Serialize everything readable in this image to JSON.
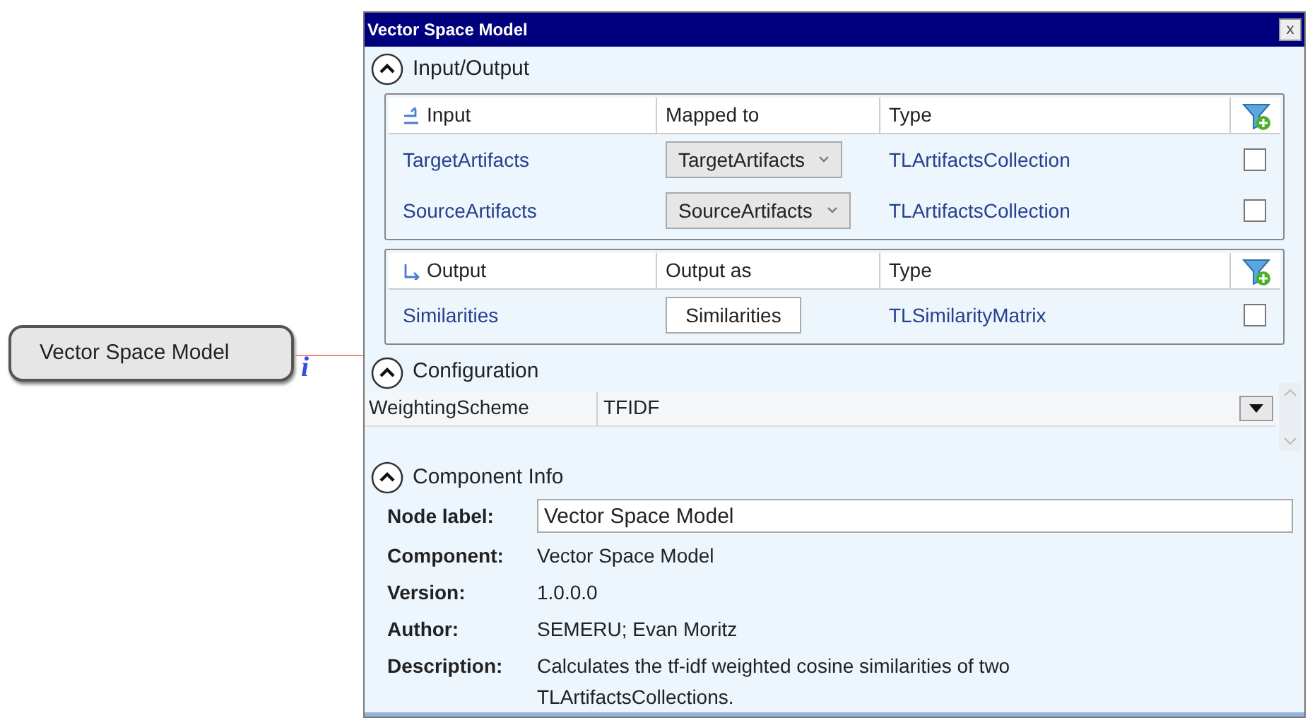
{
  "canvas_node": {
    "label": "Vector Space Model",
    "info": "i"
  },
  "window": {
    "title": "Vector Space Model",
    "close": "x"
  },
  "input_output": {
    "header": "Input/Output",
    "expanded": true,
    "tables": [
      {
        "kind": "input",
        "columns": [
          "Input",
          "Mapped to",
          "Type"
        ],
        "rows": [
          {
            "name": "TargetArtifacts",
            "mapped": "TargetArtifacts",
            "type": "TLArtifactsCollection",
            "checked": false
          },
          {
            "name": "SourceArtifacts",
            "mapped": "SourceArtifacts",
            "type": "TLArtifactsCollection",
            "checked": false
          }
        ]
      },
      {
        "kind": "output",
        "columns": [
          "Output",
          "Output as",
          "Type"
        ],
        "rows": [
          {
            "name": "Similarities",
            "mapped": "Similarities",
            "type": "TLSimilarityMatrix",
            "checked": false
          }
        ]
      }
    ]
  },
  "configuration": {
    "header": "Configuration",
    "expanded": true,
    "rows": [
      {
        "name": "WeightingScheme",
        "value": "TFIDF"
      }
    ]
  },
  "component_info": {
    "header": "Component Info",
    "expanded": true,
    "node_label": {
      "label": "Node label:",
      "value": "Vector Space Model"
    },
    "fields": [
      {
        "label": "Component:",
        "value": "Vector Space Model"
      },
      {
        "label": "Version:",
        "value": "1.0.0.0"
      },
      {
        "label": "Author:",
        "value": "SEMERU; Evan Moritz"
      },
      {
        "label": "Description:",
        "value": "Calculates the tf-idf weighted cosine similarities of two TLArtifactsCollections."
      }
    ]
  }
}
